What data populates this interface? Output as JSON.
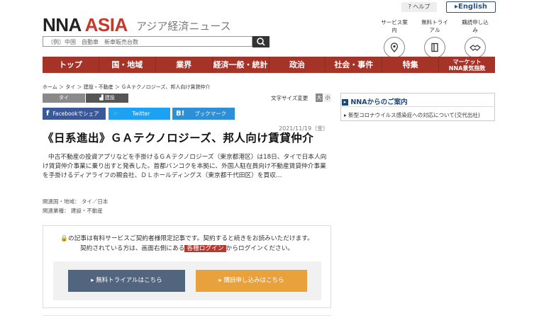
{
  "header": {
    "logo_main": "NNA",
    "logo_accent": "ASIA",
    "logo_sub": "アジア経済ニュース",
    "help_label": "ヘルプ",
    "english_label": "English",
    "search_placeholder": "（例）中国　自動車　新車販売台数",
    "tools": [
      {
        "label": "サービス案内",
        "icon": "info-pin-icon"
      },
      {
        "label": "無料トライアル",
        "icon": "book-icon"
      },
      {
        "label": "購読申し込み",
        "icon": "handshake-icon"
      }
    ]
  },
  "nav": [
    "トップ",
    "国・地域",
    "業界",
    "経済一般・統計",
    "政治",
    "社会・事件",
    "特集",
    "マーケット\nNNA景気指数"
  ],
  "breadcrumb": "ホーム ＞ タイ ＞ 建設・不動産 ＞ ＧＡテクノロジーズ、邦人向け賃貸仲介",
  "tags": [
    "タイ",
    "建設"
  ],
  "font_size": {
    "label": "文字サイズ変更",
    "large": "大",
    "small": "小"
  },
  "share": {
    "facebook": "Facebookでシェア",
    "twitter": "Twitter",
    "bookmark": "ブックマーク"
  },
  "article": {
    "date": "2021/11/19（金）",
    "title": "《日系進出》ＧＡテクノロジーズ、邦人向け賃貸仲介",
    "body": "中古不動産の投資アプリなどを手掛けるＧＡテクノロジーズ（東京都港区）は18日、タイで日本人向け賃貸仲介事業に乗り出すと発表した。首都バンコクを本拠に、外国人駐在員向け不動産賃貸仲介事業を手掛けるディアライフの親会社、ＤＬホールディングス（東京都千代田区）を買収…",
    "related_country": "関連国・地域： タイ／日本",
    "related_industry": "関連業種： 建設・不動産"
  },
  "paywall": {
    "line1": "の記事は有料サービスご契約者様限定記事です。契約すると続きをお読みいただけます。",
    "line2_pre": "契約されている方は、画面右側にある",
    "login_badge": "各種ログイン",
    "line2_post": "からログインください。",
    "trial_button": "無料トライアルはこちら",
    "subscribe_button": "購読申し込みはこちら"
  },
  "sidebar": {
    "heading": "NNAからのご案内",
    "item": "新型コロナウイルス感染症への対応について(交代出社)"
  },
  "colors": {
    "brand_red": "#a63328",
    "facebook": "#3b5998",
    "twitter": "#1da1f2",
    "hatena": "#2d8fd5",
    "trial": "#51657e",
    "subscribe": "#e9a23b"
  }
}
